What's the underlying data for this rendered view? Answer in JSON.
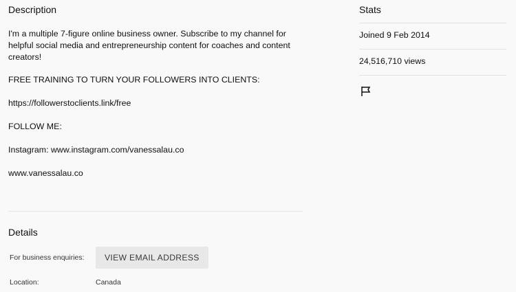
{
  "description": {
    "title": "Description",
    "lines": [
      "I'm a multiple 7-figure online business owner.  Subscribe to my channel for",
      "helpful social media and entrepreneurship content for coaches and content",
      "creators!",
      "FREE TRAINING TO TURN YOUR FOLLOWERS INTO CLIENTS:",
      "https://followerstoclients.link/free",
      "FOLLOW ME:",
      "Instagram: www.instagram.com/vanessalau.co",
      "www.vanessalau.co"
    ]
  },
  "details": {
    "title": "Details",
    "business_label": "For business enquiries:",
    "email_button": "VIEW EMAIL ADDRESS",
    "location_label": "Location:",
    "location_value": "Canada"
  },
  "stats": {
    "title": "Stats",
    "joined": "Joined 9 Feb 2014",
    "views": "24,516,710 views"
  },
  "icons": {
    "report": "flag-icon"
  }
}
